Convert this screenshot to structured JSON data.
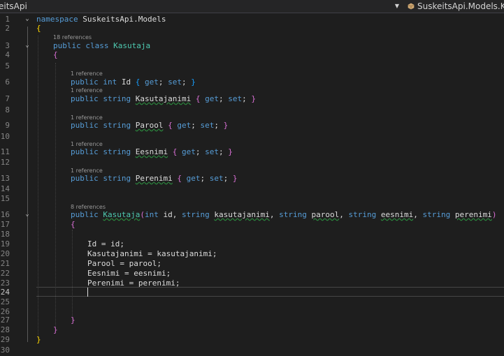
{
  "navbar": {
    "project": "eitsApi",
    "type_scope": "SuskeitsApi.Models.Kasu",
    "dropdown_icon": "triangle-down-icon",
    "class_icon": "class-icon"
  },
  "colors": {
    "background": "#1e1e1e",
    "keyword": "#569cd6",
    "type": "#4ec9b0",
    "text": "#dcdcdc",
    "line_number": "#858585",
    "codelens": "#999999"
  },
  "editor": {
    "current_line": "24",
    "line_numbers": [
      "1",
      "2",
      "3",
      "4",
      "5",
      "6",
      "7",
      "8",
      "9",
      "10",
      "11",
      "12",
      "13",
      "14",
      "15",
      "16",
      "17",
      "18",
      "19",
      "20",
      "21",
      "22",
      "23",
      "24",
      "25",
      "26",
      "27",
      "28",
      "29",
      "30"
    ],
    "codelens": {
      "class_refs": "18 references",
      "id_refs": "1 reference",
      "kasutajanimi_refs": "1 reference",
      "parool_refs": "1 reference",
      "eesnimi_refs": "1 reference",
      "perenimi_refs": "1 reference",
      "ctor_refs": "8 references"
    },
    "tokens": {
      "namespace_kw": "namespace",
      "namespace_name": "SuskeitsApi.Models",
      "open_brace": "{",
      "close_brace": "}",
      "public_kw": "public",
      "class_kw": "class",
      "int_kw": "int",
      "string_kw": "string",
      "get_kw": "get",
      "set_kw": "set",
      "class_name": "Kasutaja",
      "prop_id": "Id",
      "prop_kasutajanimi": "Kasutajanimi",
      "prop_parool": "Parool",
      "prop_eesnimi": "Eesnimi",
      "prop_perenimi": "Perenimi",
      "param_id": "id",
      "param_kasutajanimi": "kasutajanimi",
      "param_parool": "parool",
      "param_eesnimi": "eesnimi",
      "param_perenimi": "perenimi",
      "semicolon": ";",
      "comma": ",",
      "open_paren": "(",
      "close_paren": ")",
      "assign": "="
    }
  }
}
